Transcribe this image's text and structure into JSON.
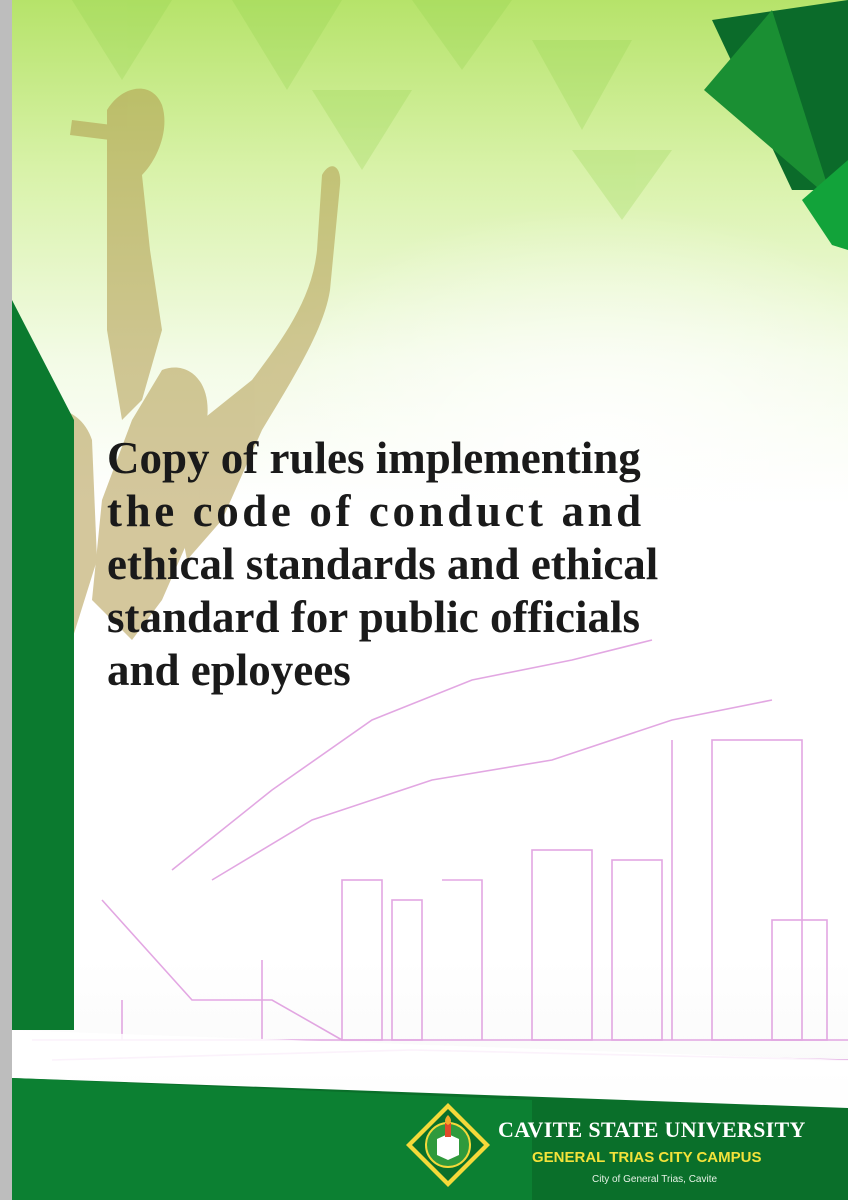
{
  "title_lines": [
    "Copy of rules implementing",
    "the code of conduct and",
    "ethical standards and ethical",
    "standard for public officials",
    "and eployees"
  ],
  "university": {
    "name": "CAVITE STATE UNIVERSITY",
    "campus": "GENERAL TRIAS CITY CAMPUS",
    "city": "City of General Trias, Cavite"
  },
  "colors": {
    "brand_green": "#0e7a2f",
    "light_green": "#b6e36a",
    "campus_yellow": "#f3e23a"
  }
}
